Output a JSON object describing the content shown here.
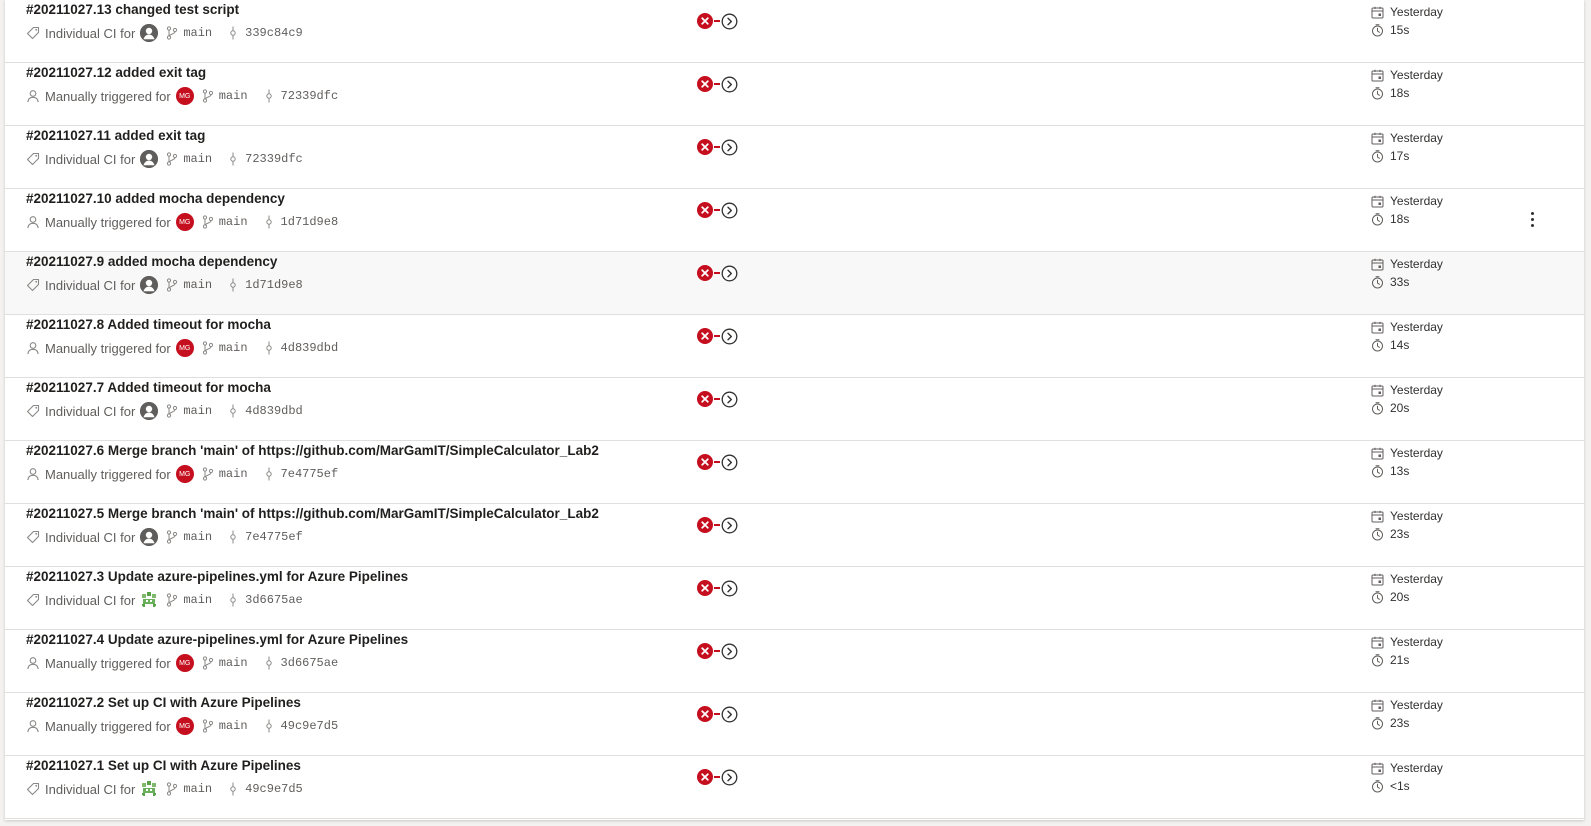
{
  "colors": {
    "failed": "#c50f1f",
    "border": "#e1dfdd",
    "text": "#323130",
    "muted": "#605e5c"
  },
  "runs": [
    {
      "title": "#20211027.13 changed test script",
      "trigger_type": "ci",
      "trigger_label": "Individual CI for",
      "avatar": "ci",
      "avatar_text": "",
      "branch": "main",
      "commit": "339c84c9",
      "when": "Yesterday",
      "duration": "15s",
      "status": "failed"
    },
    {
      "title": "#20211027.12 added exit tag",
      "trigger_type": "manual",
      "trigger_label": "Manually triggered for",
      "avatar": "mg",
      "avatar_text": "MG",
      "branch": "main",
      "commit": "72339dfc",
      "when": "Yesterday",
      "duration": "18s",
      "status": "failed"
    },
    {
      "title": "#20211027.11 added exit tag",
      "trigger_type": "ci",
      "trigger_label": "Individual CI for",
      "avatar": "ci",
      "avatar_text": "",
      "branch": "main",
      "commit": "72339dfc",
      "when": "Yesterday",
      "duration": "17s",
      "status": "failed"
    },
    {
      "title": "#20211027.10 added mocha dependency",
      "trigger_type": "manual",
      "trigger_label": "Manually triggered for",
      "avatar": "mg",
      "avatar_text": "MG",
      "branch": "main",
      "commit": "1d71d9e8",
      "when": "Yesterday",
      "duration": "18s",
      "status": "failed",
      "more": true
    },
    {
      "title": "#20211027.9 added mocha dependency",
      "trigger_type": "ci",
      "trigger_label": "Individual CI for",
      "avatar": "ci",
      "avatar_text": "",
      "branch": "main",
      "commit": "1d71d9e8",
      "when": "Yesterday",
      "duration": "33s",
      "status": "failed",
      "hovered": true
    },
    {
      "title": "#20211027.8 Added timeout for mocha",
      "trigger_type": "manual",
      "trigger_label": "Manually triggered for",
      "avatar": "mg",
      "avatar_text": "MG",
      "branch": "main",
      "commit": "4d839dbd",
      "when": "Yesterday",
      "duration": "14s",
      "status": "failed"
    },
    {
      "title": "#20211027.7 Added timeout for mocha",
      "trigger_type": "ci",
      "trigger_label": "Individual CI for",
      "avatar": "ci",
      "avatar_text": "",
      "branch": "main",
      "commit": "4d839dbd",
      "when": "Yesterday",
      "duration": "20s",
      "status": "failed"
    },
    {
      "title": "#20211027.6 Merge branch 'main' of https://github.com/MarGamIT/SimpleCalculator_Lab2",
      "trigger_type": "manual",
      "trigger_label": "Manually triggered for",
      "avatar": "mg",
      "avatar_text": "MG",
      "branch": "main",
      "commit": "7e4775ef",
      "when": "Yesterday",
      "duration": "13s",
      "status": "failed"
    },
    {
      "title": "#20211027.5 Merge branch 'main' of https://github.com/MarGamIT/SimpleCalculator_Lab2",
      "trigger_type": "ci",
      "trigger_label": "Individual CI for",
      "avatar": "ci",
      "avatar_text": "",
      "branch": "main",
      "commit": "7e4775ef",
      "when": "Yesterday",
      "duration": "23s",
      "status": "failed"
    },
    {
      "title": "#20211027.3 Update azure-pipelines.yml for Azure Pipelines",
      "trigger_type": "ci",
      "trigger_label": "Individual CI for",
      "avatar": "bot",
      "avatar_text": "",
      "branch": "main",
      "commit": "3d6675ae",
      "when": "Yesterday",
      "duration": "20s",
      "status": "failed"
    },
    {
      "title": "#20211027.4 Update azure-pipelines.yml for Azure Pipelines",
      "trigger_type": "manual",
      "trigger_label": "Manually triggered for",
      "avatar": "mg",
      "avatar_text": "MG",
      "branch": "main",
      "commit": "3d6675ae",
      "when": "Yesterday",
      "duration": "21s",
      "status": "failed"
    },
    {
      "title": "#20211027.2 Set up CI with Azure Pipelines",
      "trigger_type": "manual",
      "trigger_label": "Manually triggered for",
      "avatar": "mg",
      "avatar_text": "MG",
      "branch": "main",
      "commit": "49c9e7d5",
      "when": "Yesterday",
      "duration": "23s",
      "status": "failed"
    },
    {
      "title": "#20211027.1 Set up CI with Azure Pipelines",
      "trigger_type": "ci",
      "trigger_label": "Individual CI for",
      "avatar": "bot",
      "avatar_text": "",
      "branch": "main",
      "commit": "49c9e7d5",
      "when": "Yesterday",
      "duration": "<1s",
      "status": "failed"
    }
  ]
}
